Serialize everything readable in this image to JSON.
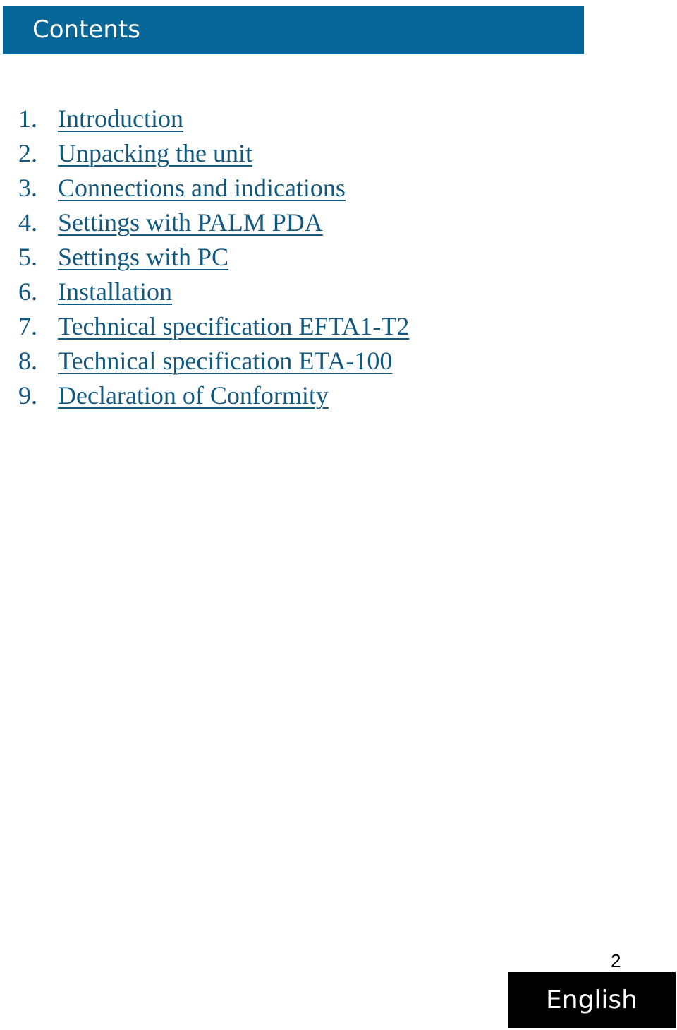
{
  "header": {
    "title": "Contents",
    "background_color": "#066698",
    "text_color": "#ffffff"
  },
  "toc": {
    "link_color": "#13587f",
    "items": [
      {
        "number": "1.",
        "label": "Introduction"
      },
      {
        "number": "2.",
        "label": "Unpacking the unit"
      },
      {
        "number": "3.",
        "label": "Connections and indications"
      },
      {
        "number": "4.",
        "label": "Settings with PALM PDA"
      },
      {
        "number": "5.",
        "label": "Settings with PC"
      },
      {
        "number": "6.",
        "label": "Installation"
      },
      {
        "number": "7.",
        "label": "Technical specification EFTA1-T2"
      },
      {
        "number": "8.",
        "label": "Technical specification ETA-100"
      },
      {
        "number": "9.",
        "label": "Declaration of Conformity"
      }
    ]
  },
  "footer": {
    "page_number": "2",
    "language_label": "English"
  }
}
